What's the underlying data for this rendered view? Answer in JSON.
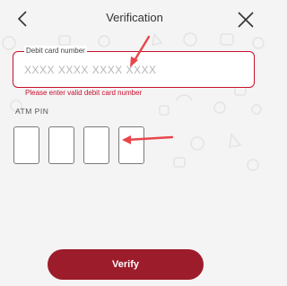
{
  "header": {
    "title": "Verification",
    "back_icon": "chevron-left-icon",
    "close_icon": "close-icon"
  },
  "card_field": {
    "label": "Debit card number",
    "placeholder": "XXXX XXXX XXXX XXXX",
    "value": "",
    "error": "Please enter valid debit card number"
  },
  "pin": {
    "label": "ATM PIN",
    "digits": [
      "",
      "",
      "",
      ""
    ]
  },
  "verify_button": {
    "label": "Verify"
  },
  "colors": {
    "accent": "#c8102e",
    "button": "#9c1c2b",
    "background": "#f4f4f4",
    "annotation_arrow": "#e8464a"
  }
}
